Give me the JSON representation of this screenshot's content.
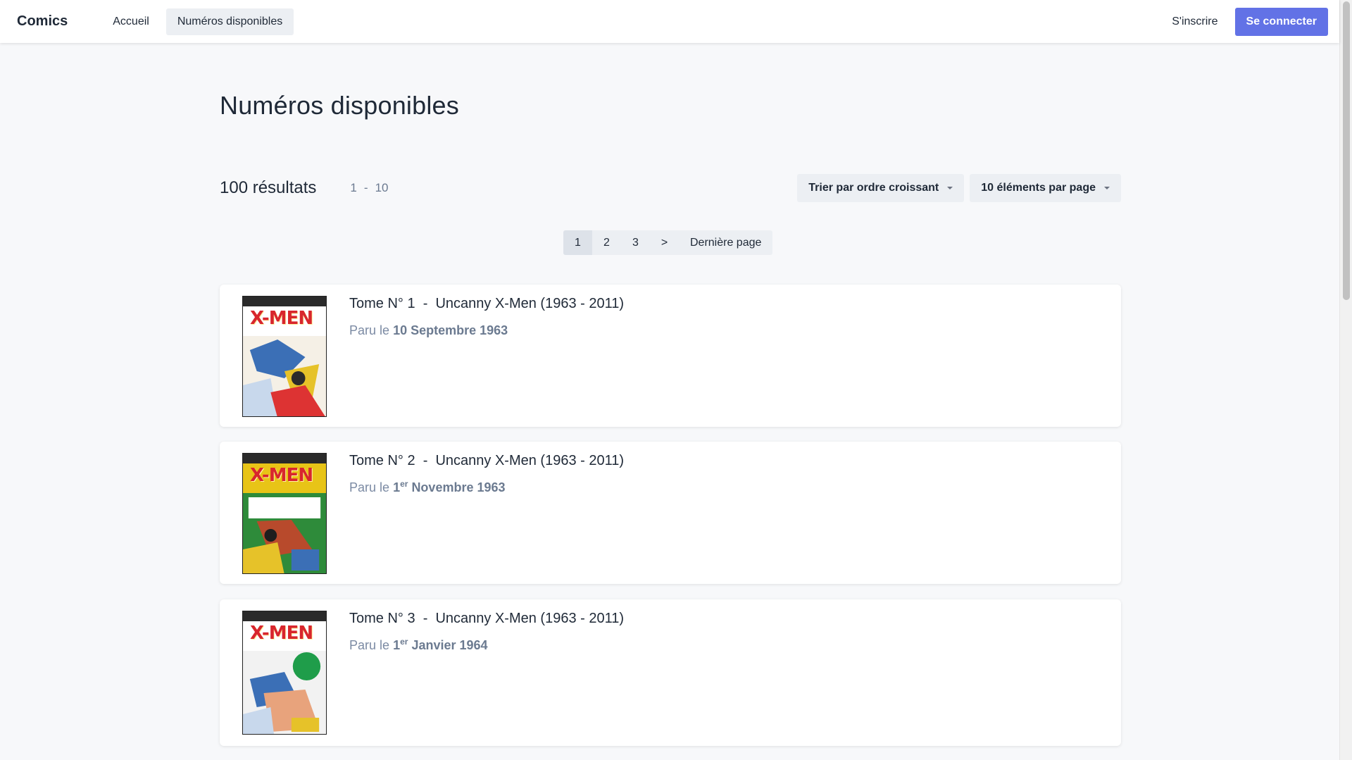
{
  "header": {
    "brand": "Comics",
    "nav": [
      {
        "label": "Accueil",
        "active": false
      },
      {
        "label": "Numéros disponibles",
        "active": true
      }
    ],
    "signup_label": "S'inscrire",
    "login_label": "Se connecter"
  },
  "page": {
    "title": "Numéros disponibles",
    "results_count": "100 résultats",
    "range_start": "1",
    "range_sep": "-",
    "range_end": "10",
    "sort_label": "Trier par ordre croissant",
    "per_page_label": "10 éléments par page"
  },
  "pagination": {
    "pages": [
      "1",
      "2",
      "3"
    ],
    "next": ">",
    "last": "Dernière page",
    "current": "1"
  },
  "comics": [
    {
      "title": "Tome N° 1  -  Uncanny X-Men (1963 - 2011)",
      "date_prefix": "Paru le",
      "date_day": "10",
      "date_sup": "",
      "date_rest": "Septembre 1963",
      "cover_bg": "#ffffff",
      "cover_accent": "#3b6fb6"
    },
    {
      "title": "Tome N° 2  -  Uncanny X-Men (1963 - 2011)",
      "date_prefix": "Paru le",
      "date_day": "1",
      "date_sup": "er",
      "date_rest": "Novembre 1963",
      "cover_bg": "#e8c417",
      "cover_accent": "#2e8b3a"
    },
    {
      "title": "Tome N° 3  -  Uncanny X-Men (1963 - 2011)",
      "date_prefix": "Paru le",
      "date_day": "1",
      "date_sup": "er",
      "date_rest": "Janvier 1964",
      "cover_bg": "#ffffff",
      "cover_accent": "#1f9d4a"
    }
  ],
  "colors": {
    "accent": "#6272e6",
    "muted_text": "#7b8aa3",
    "chip_bg": "#eceff3"
  }
}
